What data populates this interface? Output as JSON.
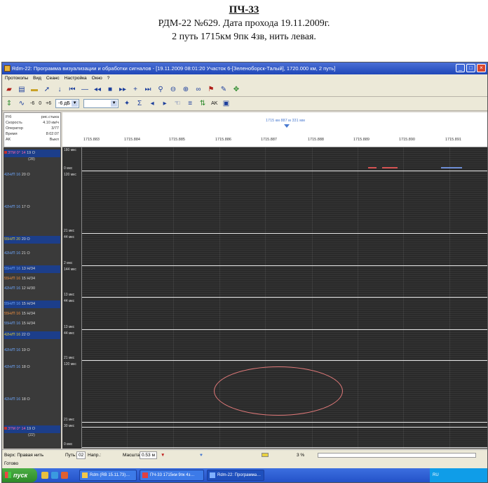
{
  "doc": {
    "title": "ПЧ-33",
    "line1": "РДМ-22 №629. Дата прохода 19.11.2009г.",
    "line2": "2 путь 1715км 9пк 4зв, нить левая."
  },
  "window": {
    "title": "Rdm-22: Программа визуализации и обработки сигналов - [19.11.2009 08:01:20 Участок 6-[Зеленоборск-Талый], 1720.000 км, 2 путь]",
    "buttons": [
      "_",
      "□",
      "×"
    ]
  },
  "menu": [
    "Протоколы",
    "Вид",
    "Сеанс",
    "Настройка",
    "Окно",
    "?"
  ],
  "toolbar2": {
    "gain_minus": "-6",
    "gain_zero": "0",
    "gain_plus": "+6",
    "db_value": "-6 дБ",
    "ak_label": "AK"
  },
  "info": [
    {
      "label": "Р/б",
      "value": "рис.стыка"
    },
    {
      "label": "Скорость",
      "value": "4.10 км/ч"
    },
    {
      "label": "Оператор",
      "value": "3/77"
    },
    {
      "label": "Время",
      "value": "8:02:07"
    },
    {
      "label": "AK",
      "value": "Выкл"
    }
  ],
  "channels": [
    {
      "name": "ЗТМ 0° 14",
      "val": "19 О",
      "sub": "(28)"
    },
    {
      "name": "42Н/П 16",
      "val": "20 О"
    },
    {
      "name": "42Н/П 16",
      "val": "17 О"
    },
    {
      "name": "55Н/П 20",
      "val": "20 О"
    },
    {
      "name": "42Н/П 16",
      "val": "21 О"
    },
    {
      "name": "55Н/П 16",
      "val": "13 Н/34"
    },
    {
      "name": "55Н/П 16",
      "val": "15 Н/34"
    },
    {
      "name": "42Н/П 16",
      "val": "12 Н/30"
    },
    {
      "name": "55Н/П 16",
      "val": "15 Н/34"
    },
    {
      "name": "55Н/П 16",
      "val": "15 Н/34"
    },
    {
      "name": "55Н/П 16",
      "val": "15 Н/34"
    },
    {
      "name": "42Н/П 16",
      "val": "22 О"
    },
    {
      "name": "42Н/П 16",
      "val": "19 О"
    },
    {
      "name": "42Н/П 16",
      "val": "18 О"
    },
    {
      "name": "42Н/П 16",
      "val": "18 О"
    },
    {
      "name": "ЗТМ 0° 14",
      "val": "19 О",
      "sub": "(22)"
    }
  ],
  "ruler": {
    "marker": "1715 км 887 м 331 мм",
    "ticks": [
      "1715.883",
      "1715.884",
      "1715.885",
      "1715.886",
      "1715.887",
      "1715.888",
      "1715.889",
      "1715.890",
      "1715.891"
    ]
  },
  "ylabels": [
    "180 мкс",
    "0 мкс",
    "120 мкс",
    "21 мкс",
    "44 мкс",
    "2 мкс",
    "144 мкс",
    "13 мкс",
    "44 мкс",
    "13 мкс",
    "44 мкс",
    "21 мкс",
    "120 мкс",
    "21 мкс",
    "30 мкс",
    "0 мкс"
  ],
  "status": {
    "rail": "Верх: Правая нить",
    "path_label": "Путь:",
    "path_value": "02",
    "dir_label": "Напр.:",
    "scale_label": "Масштаб",
    "scale_value": "0.53 м",
    "percent": "3 %",
    "ready": "Готово"
  },
  "taskbar": {
    "start": "пуск",
    "items": [
      "Rdm (RB 15.11.73)…",
      "ПЧ-33 1715км 9пк 4з…",
      "Rdm-22: Программа…"
    ],
    "tray": "RU"
  },
  "colors": {
    "titlebar": "#1f47b8",
    "plot_bg": "#2a2a2a",
    "annotation": "#e27a7a",
    "start_button": "#2d8a28"
  }
}
